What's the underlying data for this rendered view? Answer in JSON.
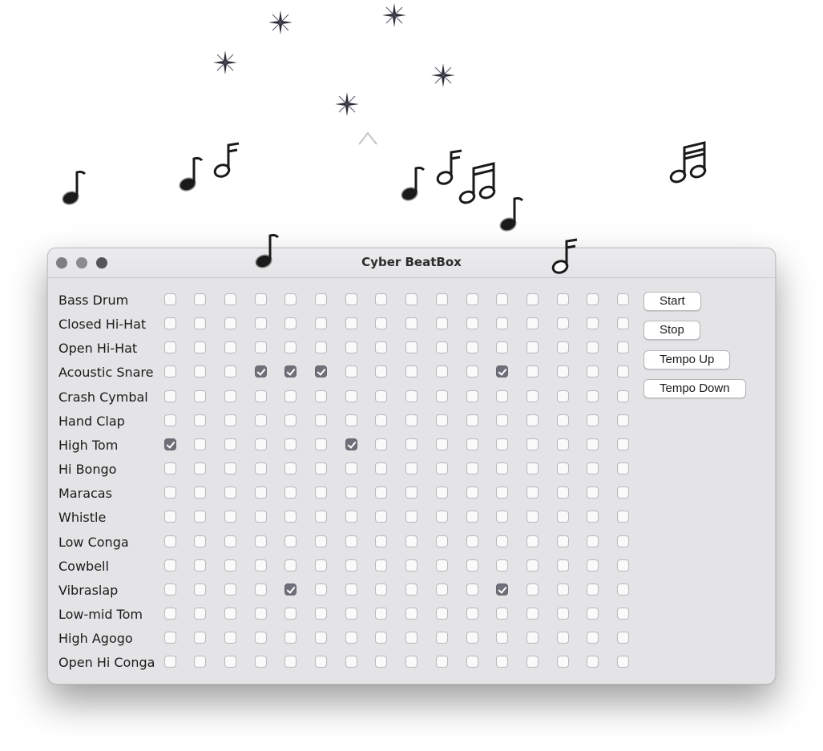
{
  "window": {
    "title": "Cyber BeatBox"
  },
  "instruments": [
    {
      "name": "Bass Drum",
      "steps": [
        0,
        0,
        0,
        0,
        0,
        0,
        0,
        0,
        0,
        0,
        0,
        0,
        0,
        0,
        0,
        0
      ]
    },
    {
      "name": "Closed Hi-Hat",
      "steps": [
        0,
        0,
        0,
        0,
        0,
        0,
        0,
        0,
        0,
        0,
        0,
        0,
        0,
        0,
        0,
        0
      ]
    },
    {
      "name": "Open Hi-Hat",
      "steps": [
        0,
        0,
        0,
        0,
        0,
        0,
        0,
        0,
        0,
        0,
        0,
        0,
        0,
        0,
        0,
        0
      ]
    },
    {
      "name": "Acoustic Snare",
      "steps": [
        0,
        0,
        0,
        1,
        1,
        1,
        0,
        0,
        0,
        0,
        0,
        1,
        0,
        0,
        0,
        0
      ]
    },
    {
      "name": "Crash Cymbal",
      "steps": [
        0,
        0,
        0,
        0,
        0,
        0,
        0,
        0,
        0,
        0,
        0,
        0,
        0,
        0,
        0,
        0
      ]
    },
    {
      "name": "Hand Clap",
      "steps": [
        0,
        0,
        0,
        0,
        0,
        0,
        0,
        0,
        0,
        0,
        0,
        0,
        0,
        0,
        0,
        0
      ]
    },
    {
      "name": "High Tom",
      "steps": [
        1,
        0,
        0,
        0,
        0,
        0,
        1,
        0,
        0,
        0,
        0,
        0,
        0,
        0,
        0,
        0
      ]
    },
    {
      "name": "Hi Bongo",
      "steps": [
        0,
        0,
        0,
        0,
        0,
        0,
        0,
        0,
        0,
        0,
        0,
        0,
        0,
        0,
        0,
        0
      ]
    },
    {
      "name": "Maracas",
      "steps": [
        0,
        0,
        0,
        0,
        0,
        0,
        0,
        0,
        0,
        0,
        0,
        0,
        0,
        0,
        0,
        0
      ]
    },
    {
      "name": "Whistle",
      "steps": [
        0,
        0,
        0,
        0,
        0,
        0,
        0,
        0,
        0,
        0,
        0,
        0,
        0,
        0,
        0,
        0
      ]
    },
    {
      "name": "Low Conga",
      "steps": [
        0,
        0,
        0,
        0,
        0,
        0,
        0,
        0,
        0,
        0,
        0,
        0,
        0,
        0,
        0,
        0
      ]
    },
    {
      "name": "Cowbell",
      "steps": [
        0,
        0,
        0,
        0,
        0,
        0,
        0,
        0,
        0,
        0,
        0,
        0,
        0,
        0,
        0,
        0
      ]
    },
    {
      "name": "Vibraslap",
      "steps": [
        0,
        0,
        0,
        0,
        1,
        0,
        0,
        0,
        0,
        0,
        0,
        1,
        0,
        0,
        0,
        0
      ]
    },
    {
      "name": "Low-mid Tom",
      "steps": [
        0,
        0,
        0,
        0,
        0,
        0,
        0,
        0,
        0,
        0,
        0,
        0,
        0,
        0,
        0,
        0
      ]
    },
    {
      "name": "High Agogo",
      "steps": [
        0,
        0,
        0,
        0,
        0,
        0,
        0,
        0,
        0,
        0,
        0,
        0,
        0,
        0,
        0,
        0
      ]
    },
    {
      "name": "Open Hi Conga",
      "steps": [
        0,
        0,
        0,
        0,
        0,
        0,
        0,
        0,
        0,
        0,
        0,
        0,
        0,
        0,
        0,
        0
      ]
    }
  ],
  "buttons": {
    "start": "Start",
    "stop": "Stop",
    "tempo_up": "Tempo Up",
    "tempo_down": "Tempo Down"
  },
  "decorations": {
    "sparkle_icon": "sparkle-icon",
    "note_icons": [
      "eighth-note-icon",
      "beamed-sixteenth-notes-icon"
    ]
  },
  "colors": {
    "checked": "#6f6f79",
    "window_bg": "#e4e4e6",
    "note": "#1a1a1a"
  }
}
